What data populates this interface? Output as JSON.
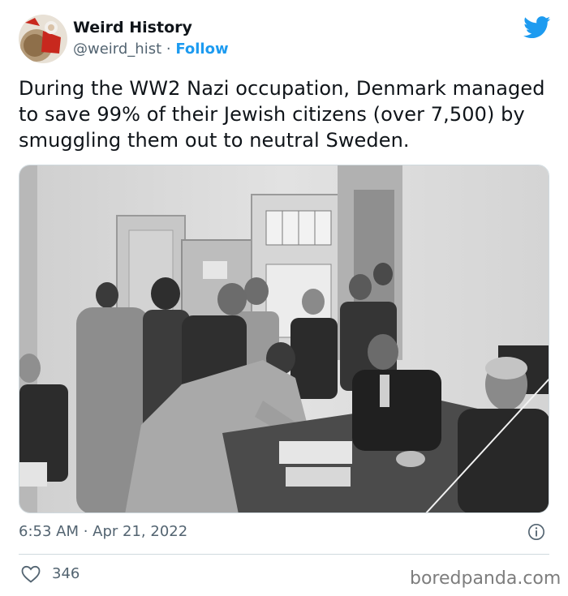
{
  "author": {
    "display_name": "Weird History",
    "handle": "@weird_hist",
    "separator": " · ",
    "follow_label": "Follow"
  },
  "tweet": {
    "text": "During the WW2 Nazi occupation, Denmark managed to save 99% of their Jewish citizens (over 7,500) by smuggling them out to neutral Sweden."
  },
  "meta": {
    "timestamp": "6:53 AM · Apr 21, 2022"
  },
  "engagement": {
    "likes": "346"
  },
  "watermark": "boredpanda.com",
  "colors": {
    "accent": "#1d9bf0",
    "text": "#0f1419",
    "secondary": "#536471",
    "divider": "#cfd9de"
  },
  "icons": [
    "twitter-bird-icon",
    "info-icon",
    "heart-icon"
  ]
}
